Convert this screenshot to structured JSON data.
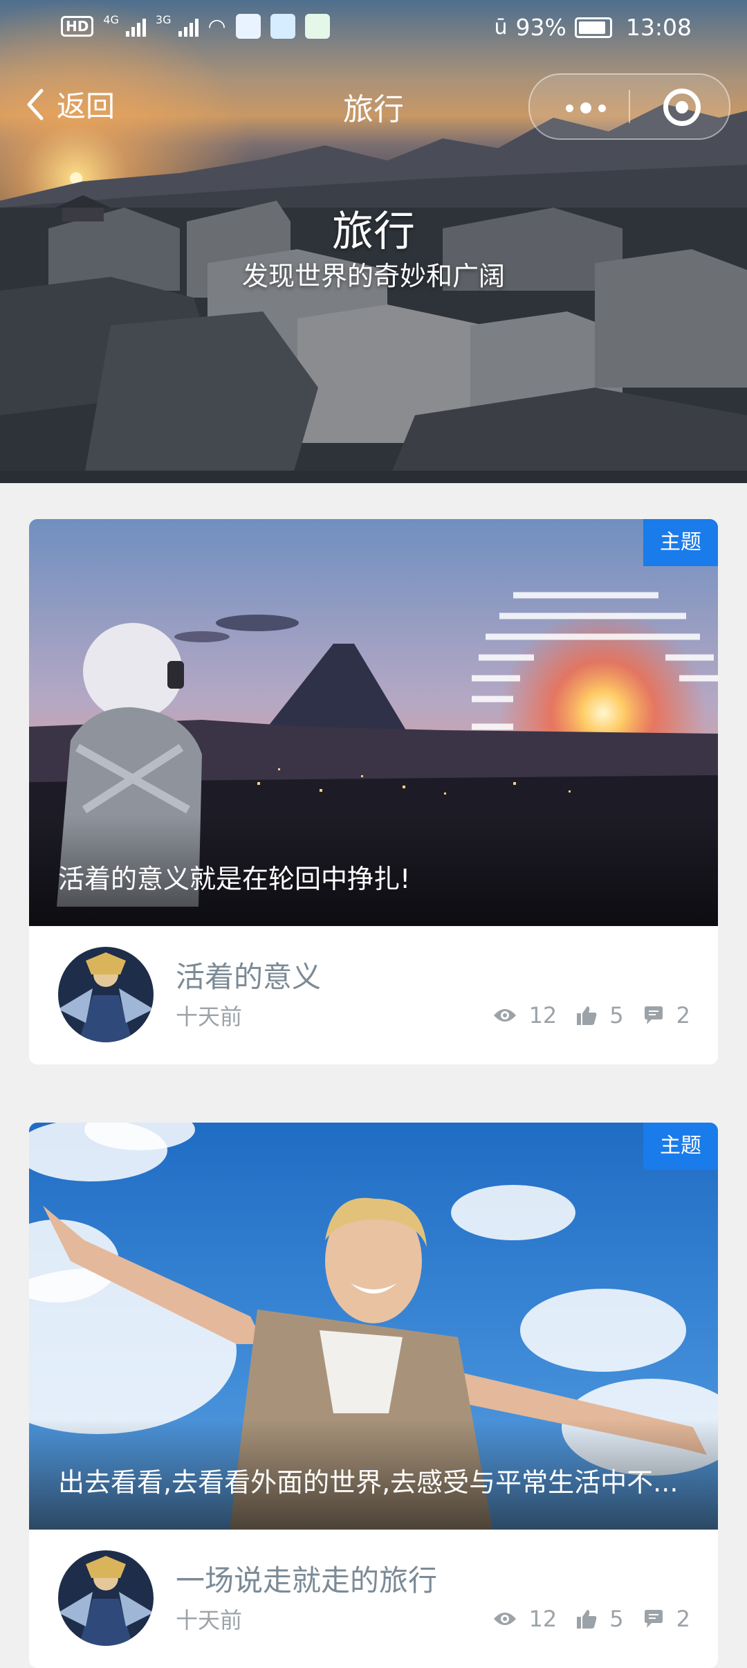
{
  "status_bar": {
    "hd": "HD",
    "net1": "4G",
    "net2": "3G",
    "battery": "93%",
    "time": "13:08"
  },
  "nav": {
    "back_label": "返回",
    "title": "旅行"
  },
  "hero": {
    "title": "旅行",
    "subtitle": "发现世界的奇妙和广阔"
  },
  "posts": [
    {
      "tag": "主题",
      "caption": "活着的意义就是在轮回中挣扎!",
      "title": "活着的意义",
      "time": "十天前",
      "views": "12",
      "likes": "5",
      "comments": "2"
    },
    {
      "tag": "主题",
      "caption": "出去看看,去看看外面的世界,去感受与平常生活中不...",
      "title": "一场说走就走的旅行",
      "time": "十天前",
      "views": "12",
      "likes": "5",
      "comments": "2"
    }
  ],
  "colors": {
    "tag_blue": "#1a7bea",
    "page_bg": "#f0f0f0",
    "meta_gray": "#9ca3a8"
  }
}
